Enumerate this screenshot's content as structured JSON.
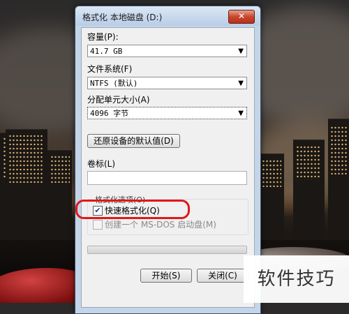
{
  "dialog": {
    "title": "格式化 本地磁盘 (D:)",
    "close_label": "✕",
    "capacity": {
      "label": "容量(P):",
      "value": "41.7 GB"
    },
    "filesystem": {
      "label": "文件系统(F)",
      "value": "NTFS (默认)"
    },
    "allocation": {
      "label": "分配单元大小(A)",
      "value": "4096 字节"
    },
    "restore_defaults_label": "还原设备的默认值(D)",
    "volume_label": {
      "label": "卷标(L)",
      "value": ""
    },
    "format_options": {
      "label": "格式化选项(O)",
      "quick_format": {
        "label": "快速格式化(Q)",
        "checked": true
      },
      "msdos_disk": {
        "label": "创建一个 MS-DOS 启动盘(M)",
        "checked": false,
        "disabled": true
      }
    },
    "start_label": "开始(S)",
    "close_button_label": "关闭(C)"
  },
  "watermark": {
    "text": "软件技巧"
  },
  "colors": {
    "highlight": "#e01818",
    "close_button": "#c9462c",
    "dialog_frame": "#c5d5e8"
  }
}
